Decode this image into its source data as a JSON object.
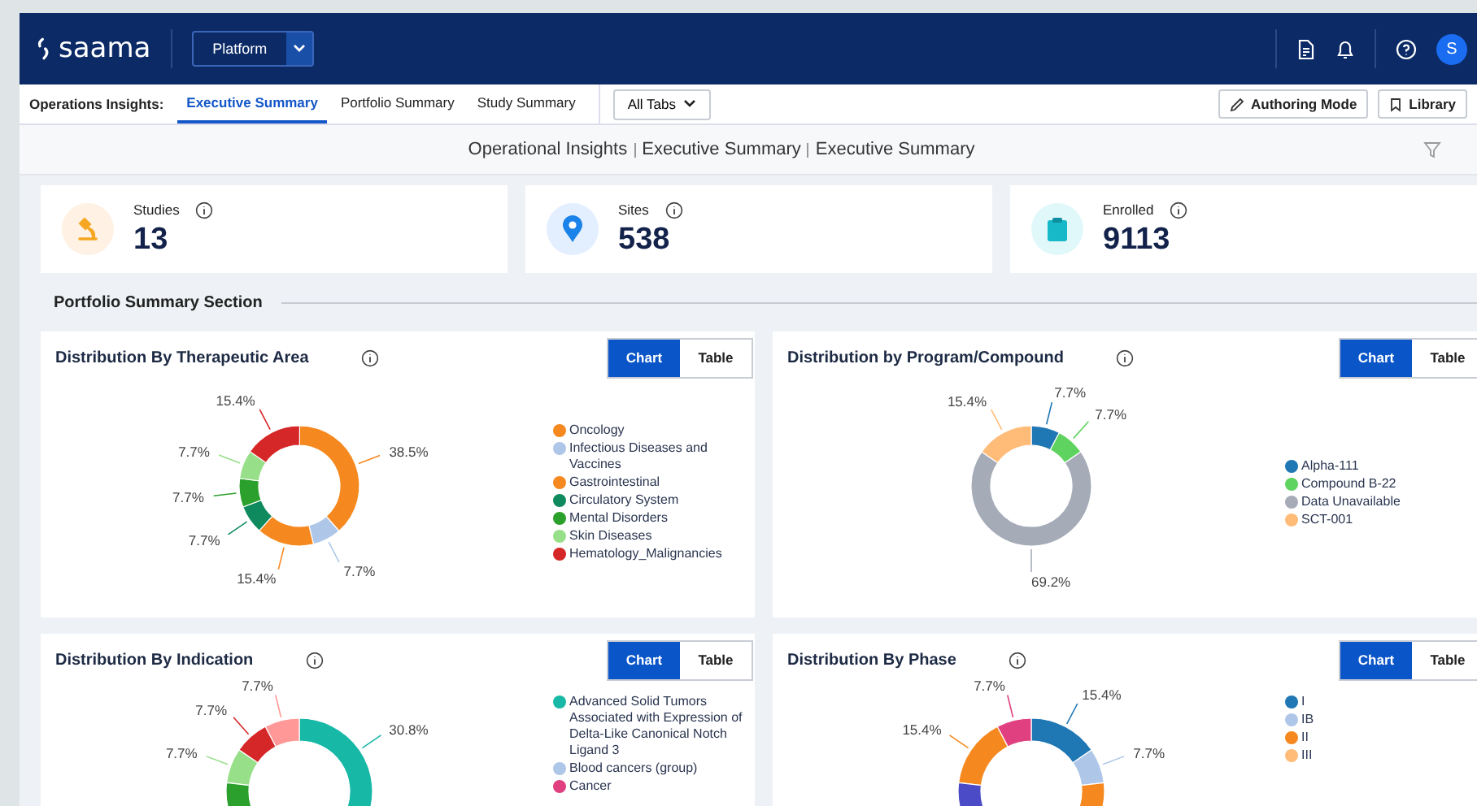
{
  "header": {
    "logo": "saama",
    "platform": "Platform",
    "avatar": "S"
  },
  "nav": {
    "label": "Operations Insights:",
    "tabs": [
      {
        "label": "Executive Summary",
        "selected": true
      },
      {
        "label": "Portfolio Summary",
        "selected": false
      },
      {
        "label": "Study Summary",
        "selected": false
      }
    ],
    "all_tabs": "All Tabs",
    "buttons": [
      {
        "label": "Authoring Mode",
        "kind": "pencil"
      },
      {
        "label": "Library",
        "kind": "bookmark"
      }
    ]
  },
  "breadcrumb": [
    "Operational Insights",
    "Executive Summary",
    "Executive Summary"
  ],
  "kpis": [
    {
      "label": "Studies",
      "value": "13",
      "kind": "studies"
    },
    {
      "label": "Sites",
      "value": "538",
      "kind": "sites"
    },
    {
      "label": "Enrolled",
      "value": "9113",
      "kind": "enrolled"
    }
  ],
  "section_title": "Portfolio Summary Section",
  "charts": [
    {
      "title": "Distribution By Therapeutic Area",
      "toggle": [
        {
          "label": "Chart",
          "selected": true
        },
        {
          "label": "Table",
          "selected": false
        }
      ],
      "chart_data": {
        "type": "donut",
        "values": [
          38.5,
          7.7,
          15.4,
          7.7,
          7.7,
          7.7,
          15.4
        ],
        "colors": [
          "#f5891f",
          "#aec7e8",
          "#f5891f",
          "#0f8a5f",
          "#2ca02c",
          "#98df8a",
          "#d62728"
        ],
        "value_labels": [
          "38.5%",
          "7.7%",
          "15.4%",
          "7.7%",
          "7.7%",
          "7.7%",
          "15.4%"
        ]
      },
      "legend": [
        {
          "label": "Oncology",
          "color": "#f5891f"
        },
        {
          "label": "Infectious Diseases and Vaccines",
          "color": "#aec7e8"
        },
        {
          "label": "Gastrointestinal",
          "color": "#f5891f"
        },
        {
          "label": "Circulatory System",
          "color": "#0f8a5f"
        },
        {
          "label": "Mental Disorders",
          "color": "#2ca02c"
        },
        {
          "label": "Skin Diseases",
          "color": "#98df8a"
        },
        {
          "label": "Hematology_Malignancies",
          "color": "#d62728"
        }
      ]
    },
    {
      "title": "Distribution by Program/Compound",
      "toggle": [
        {
          "label": "Chart",
          "selected": true
        },
        {
          "label": "Table",
          "selected": false
        }
      ],
      "chart_data": {
        "type": "donut",
        "values": [
          7.7,
          7.7,
          69.2,
          15.4
        ],
        "colors": [
          "#1f77b4",
          "#5fd35f",
          "#a5acb8",
          "#ffbb78"
        ],
        "value_labels": [
          "7.7%",
          "7.7%",
          "69.2%",
          "15.4%"
        ]
      },
      "legend": [
        {
          "label": "Alpha-111",
          "color": "#1f77b4"
        },
        {
          "label": "Compound B-22",
          "color": "#5fd35f"
        },
        {
          "label": "Data Unavailable",
          "color": "#a5acb8"
        },
        {
          "label": "SCT-001",
          "color": "#ffbb78"
        }
      ]
    },
    {
      "title": "Distribution By Indication",
      "toggle": [
        {
          "label": "Chart",
          "selected": true
        },
        {
          "label": "Table",
          "selected": false
        }
      ],
      "partial_donut": {
        "slices": [
          {
            "label": "30.8%",
            "color": "#17b8a6",
            "kind": "clockwise"
          },
          {
            "label": "7.7%",
            "color": "#ff9896",
            "kind": "counterclockwise"
          },
          {
            "label": "7.7%",
            "color": "#d62728",
            "kind": "counterclockwise"
          },
          {
            "label": "7.7%",
            "color": "#98df8a",
            "kind": "counterclockwise"
          },
          {
            "color": "#2ca02c",
            "kind": "counterclockwise"
          }
        ]
      },
      "legend": [
        {
          "label": "Advanced Solid Tumors Associated with Expression of Delta-Like Canonical Notch Ligand 3",
          "color": "#17b8a6"
        },
        {
          "label": "Blood cancers (group)",
          "color": "#aec7e8"
        },
        {
          "label": "Cancer",
          "color": "#e0407f"
        }
      ]
    },
    {
      "title": "Distribution By Phase",
      "toggle": [
        {
          "label": "Chart",
          "selected": true
        },
        {
          "label": "Table",
          "selected": false
        }
      ],
      "partial_donut": {
        "slices": [
          {
            "label": "15.4%",
            "color": "#1f77b4",
            "kind": "clockwise"
          },
          {
            "label": "7.7%",
            "color": "#aec7e8",
            "kind": "clockwise"
          },
          {
            "color": "#f5891f",
            "kind": "clockwise"
          },
          {
            "label": "7.7%",
            "color": "#e0407f",
            "kind": "counterclockwise"
          },
          {
            "label": "15.4%",
            "color": "#f5891f",
            "kind": "counterclockwise"
          },
          {
            "color": "#4b4bc8",
            "kind": "counterclockwise"
          }
        ]
      },
      "legend": [
        {
          "label": "I",
          "color": "#1f77b4"
        },
        {
          "label": "IB",
          "color": "#aec7e8"
        },
        {
          "label": "II",
          "color": "#f5891f"
        },
        {
          "label": "III",
          "color": "#ffbb78"
        }
      ]
    }
  ]
}
